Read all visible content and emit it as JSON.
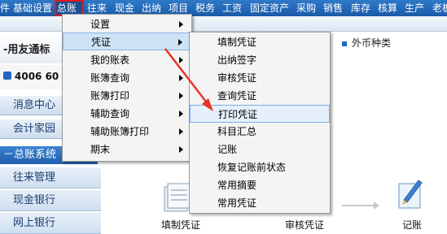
{
  "menubar": {
    "items": [
      {
        "label": "件"
      },
      {
        "label": "基础设置"
      },
      {
        "label": "总账",
        "active": true
      },
      {
        "label": "往来"
      },
      {
        "label": "现金"
      },
      {
        "label": "出纳"
      },
      {
        "label": "项目"
      },
      {
        "label": "税务"
      },
      {
        "label": "工资"
      },
      {
        "label": "固定资产"
      },
      {
        "label": "采购"
      },
      {
        "label": "销售"
      },
      {
        "label": "库存"
      },
      {
        "label": "核算"
      },
      {
        "label": "生产"
      },
      {
        "label": "老板"
      }
    ]
  },
  "brand": {
    "title": "-用友通标",
    "phone": "4006 60"
  },
  "left_nav": {
    "items": [
      {
        "label": "消息中心"
      },
      {
        "label": "会计家园"
      }
    ],
    "section": "总账系统",
    "sub_items": [
      {
        "label": "往来管理"
      },
      {
        "label": "现金银行"
      },
      {
        "label": "网上银行"
      }
    ]
  },
  "main": {
    "currency_tab": "外币种类",
    "flow": [
      {
        "label": "填制凭证"
      },
      {
        "label": "审核凭证"
      },
      {
        "label": "记账"
      }
    ]
  },
  "menu_level1": {
    "items": [
      {
        "label": "设置",
        "submenu": true
      },
      {
        "label": "凭证",
        "submenu": true
      },
      {
        "label": "我的账表",
        "submenu": true
      },
      {
        "label": "账簿查询",
        "submenu": true
      },
      {
        "label": "账簿打印",
        "submenu": true
      },
      {
        "label": "辅助查询",
        "submenu": true
      },
      {
        "label": "辅助账簿打印",
        "submenu": true
      },
      {
        "label": "期末",
        "submenu": true
      }
    ]
  },
  "menu_level2": {
    "items": [
      {
        "label": "填制凭证"
      },
      {
        "label": "出纳签字"
      },
      {
        "label": "审核凭证"
      },
      {
        "label": "查询凭证"
      },
      {
        "label": "打印凭证",
        "selected": true
      },
      {
        "label": "科目汇总"
      },
      {
        "label": "记账"
      },
      {
        "label": "恢复记账前状态"
      },
      {
        "label": "常用摘要"
      },
      {
        "label": "常用凭证"
      }
    ]
  },
  "colors": {
    "menubar": "#2a6fc0",
    "highlight_border": "#e21a1a",
    "annotation_arrow": "#e8342a"
  }
}
